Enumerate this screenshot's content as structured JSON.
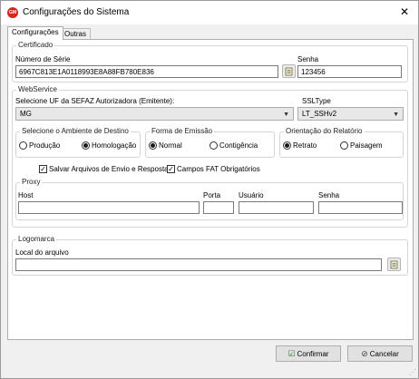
{
  "window": {
    "title": "Configurações do Sistema",
    "app_icon_text": "GM"
  },
  "tabs": [
    {
      "label": "Configurações"
    },
    {
      "label": "Outras"
    }
  ],
  "certificado": {
    "group_label": "Certificado",
    "serial_label": "Número de Série",
    "serial_value": "6967C813E1A0118993E8A88FB780E836",
    "password_label": "Senha",
    "password_value": "123456"
  },
  "webservice": {
    "group_label": "WebService",
    "uf_label": "Selecione UF da SEFAZ Autorizadora (Emitente):",
    "uf_value": "MG",
    "ssl_label": "SSLType",
    "ssl_value": "LT_SSHv2",
    "ambiente": {
      "label": "Selecione o Ambiente de Destino",
      "options": [
        "Produção",
        "Homologação"
      ],
      "selected": "Homologação"
    },
    "emissao": {
      "label": "Forma de Emissão",
      "options": [
        "Normal",
        "Contigência"
      ],
      "selected": "Normal"
    },
    "orientacao": {
      "label": "Orientação do Relatório",
      "options": [
        "Retrato",
        "Paisagem"
      ],
      "selected": "Retrato"
    },
    "salvar_arquivos": {
      "label": "Salvar Arquivos de Envio e Resposta",
      "checked": true
    },
    "campos_fat": {
      "label": "Campos FAT Obrigatórios",
      "checked": true
    },
    "proxy": {
      "group_label": "Proxy",
      "host_label": "Host",
      "host_value": "",
      "porta_label": "Porta",
      "porta_value": "",
      "usuario_label": "Usuário",
      "usuario_value": "",
      "senha_label": "Senha",
      "senha_value": ""
    }
  },
  "logomarca": {
    "group_label": "Logomarca",
    "file_label": "Local do arquivo",
    "file_value": ""
  },
  "buttons": {
    "confirm": "Confirmar",
    "cancel": "Cancelar"
  },
  "icons": {
    "browse": "folder-browse-icon",
    "confirm": "check-icon",
    "cancel": "cancel-icon",
    "close": "close-icon"
  }
}
